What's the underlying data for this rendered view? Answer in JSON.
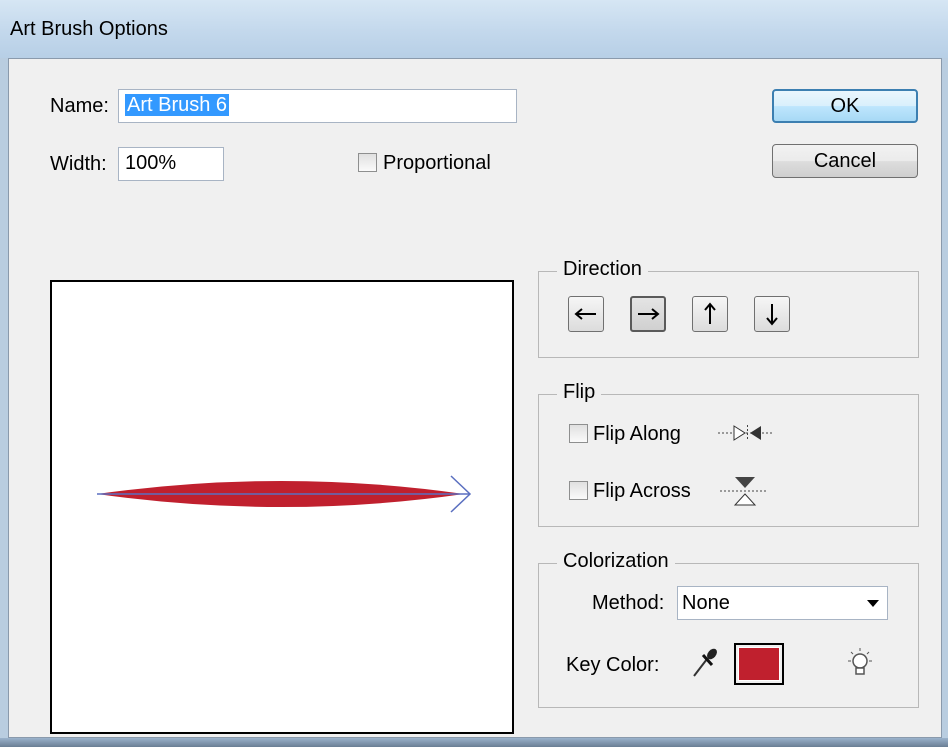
{
  "window": {
    "title": "Art Brush Options"
  },
  "name": {
    "label": "Name:",
    "value": "Art Brush 6"
  },
  "width": {
    "label": "Width:",
    "value": "100%"
  },
  "proportional": {
    "label": "Proportional",
    "checked": false
  },
  "buttons": {
    "ok": "OK",
    "cancel": "Cancel"
  },
  "direction": {
    "legend": "Direction",
    "options": [
      "left-arrow",
      "right-arrow",
      "up-arrow",
      "down-arrow"
    ],
    "selected": "right-arrow"
  },
  "flip": {
    "legend": "Flip",
    "along": {
      "label": "Flip Along",
      "checked": false,
      "icon": "flip-along-icon"
    },
    "across": {
      "label": "Flip Across",
      "checked": false,
      "icon": "flip-across-icon"
    }
  },
  "colorization": {
    "legend": "Colorization",
    "method_label": "Method:",
    "method_value": "None",
    "key_color_label": "Key Color:",
    "key_color": "#c0202e",
    "eyedropper_icon": "eyedropper-icon",
    "tips_icon": "lightbulb-icon"
  },
  "preview": {
    "brush_color": "#c0202e",
    "path_color": "#5a6fc0"
  }
}
